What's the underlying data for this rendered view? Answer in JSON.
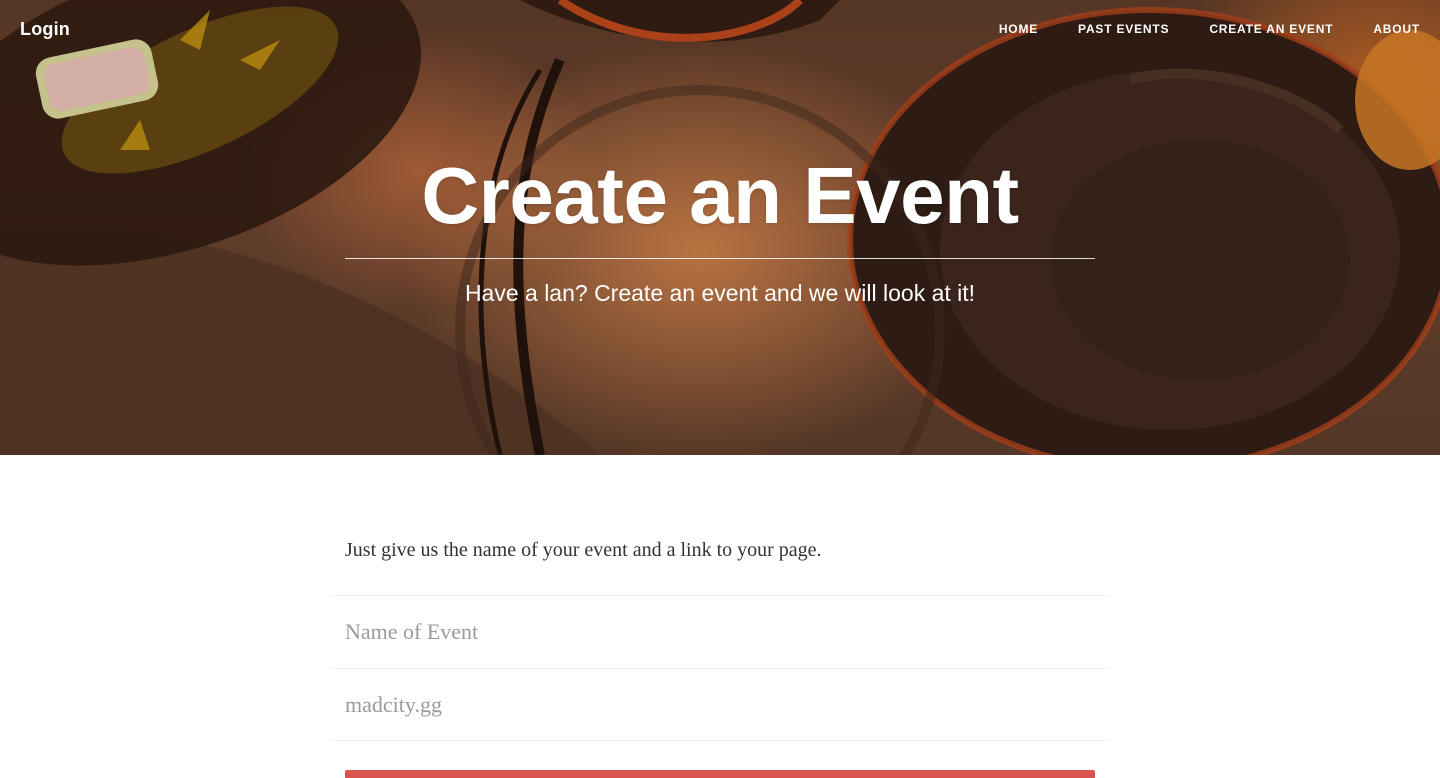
{
  "nav": {
    "brand": "Login",
    "links": [
      {
        "label": "HOME"
      },
      {
        "label": "PAST EVENTS"
      },
      {
        "label": "CREATE AN EVENT"
      },
      {
        "label": "ABOUT"
      }
    ]
  },
  "hero": {
    "heading": "Create an Event",
    "subheading": "Have a lan? Create an event and we will look at it!"
  },
  "form": {
    "intro": "Just give us the name of your event and a link to your page.",
    "event_name_placeholder": "Name of Event",
    "event_link_placeholder": "madcity.gg"
  },
  "colors": {
    "accent": "#d9534f"
  }
}
